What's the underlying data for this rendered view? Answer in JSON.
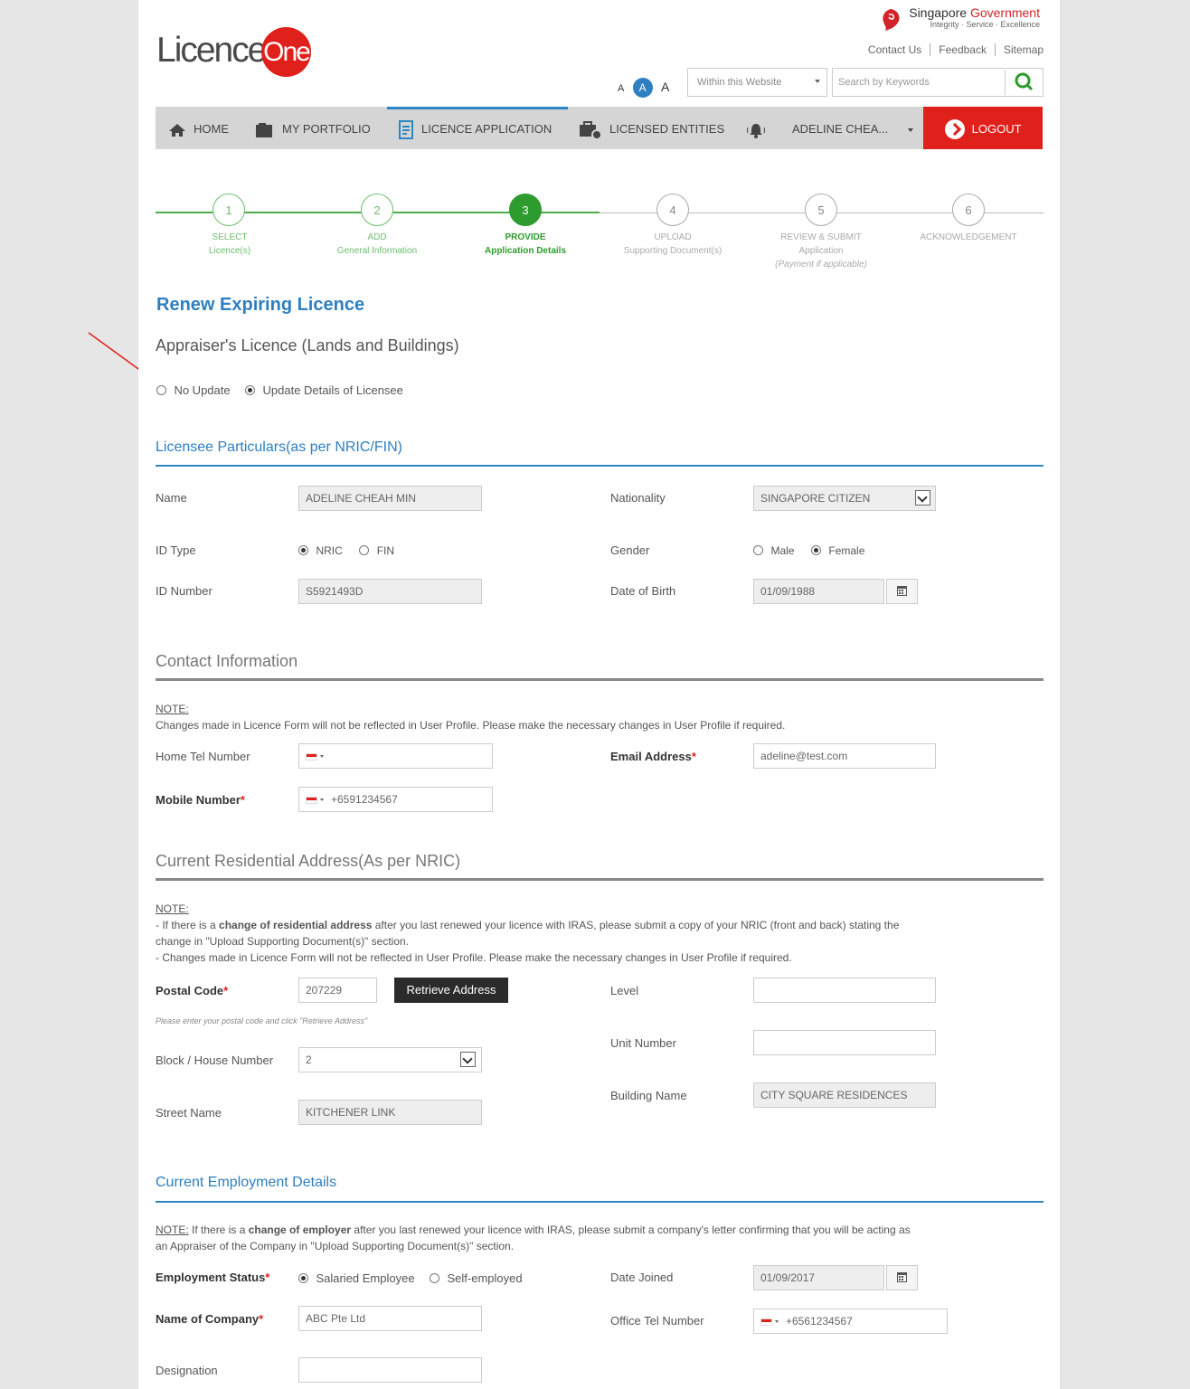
{
  "header": {
    "logo_left": "Licence",
    "logo_right": "One",
    "gov_title_1": "Singapore ",
    "gov_title_2": "Government",
    "gov_tagline": "Integrity · Service · Excellence",
    "links": [
      "Contact Us",
      "Feedback",
      "Sitemap"
    ],
    "font_small": "A",
    "font_medium": "A",
    "font_large": "A",
    "scope_select": "Within this Website",
    "search_placeholder": "Search by Keywords"
  },
  "nav": {
    "home": "HOME",
    "portfolio": "MY PORTFOLIO",
    "licence_application": "LICENCE APPLICATION",
    "licensed_entities": "LICENSED ENTITIES",
    "user": "ADELINE CHEA...",
    "logout": "LOGOUT"
  },
  "steps": [
    {
      "num": "1",
      "line1": "SELECT",
      "line2": "Licence(s)",
      "line3": ""
    },
    {
      "num": "2",
      "line1": "ADD",
      "line2": "General Information",
      "line3": ""
    },
    {
      "num": "3",
      "line1": "PROVIDE",
      "line2": "Application Details",
      "line3": ""
    },
    {
      "num": "4",
      "line1": "UPLOAD",
      "line2": "Supporting Document(s)",
      "line3": ""
    },
    {
      "num": "5",
      "line1": "REVIEW & SUBMIT",
      "line2": "Application",
      "line3": "(Payment if applicable)"
    },
    {
      "num": "6",
      "line1": "ACKNOWLEDGEMENT",
      "line2": "",
      "line3": ""
    }
  ],
  "page": {
    "title": "Renew Expiring Licence",
    "subtitle": "Appraiser's Licence (Lands and Buildings)",
    "option_no_update": "No Update",
    "option_update": "Update Details of Licensee",
    "selected_option": "Update Details of Licensee"
  },
  "licensee": {
    "heading": "Licensee Particulars(as per NRIC/FIN)",
    "name_label": "Name",
    "name_value": "ADELINE CHEAH MIN",
    "nationality_label": "Nationality",
    "nationality_value": "SINGAPORE CITIZEN",
    "idtype_label": "ID Type",
    "idtype_nric": "NRIC",
    "idtype_fin": "FIN",
    "idtype_selected": "NRIC",
    "gender_label": "Gender",
    "gender_male": "Male",
    "gender_female": "Female",
    "gender_selected": "Female",
    "idnumber_label": "ID Number",
    "idnumber_value": "S5921493D",
    "dob_label": "Date of Birth",
    "dob_value": "01/09/1988"
  },
  "contact": {
    "heading": "Contact Information",
    "note_label": "NOTE:",
    "note_text": "Changes made in Licence Form will not be reflected in User Profile. Please make the necessary changes in User Profile if required.",
    "home_tel_label": "Home Tel Number",
    "home_tel_value": "",
    "email_label": "Email Address",
    "email_value": "adeline@test.com",
    "mobile_label": "Mobile Number",
    "mobile_value": "+6591234567",
    "required_mark": "*"
  },
  "address": {
    "heading": "Current Residential Address(As per NRIC)",
    "note_label": "NOTE:",
    "note_line1_a": "- If there is a ",
    "note_line1_b": "change of residential address",
    "note_line1_c": " after you last renewed your licence with IRAS, please submit a copy of your NRIC (front and back) stating the",
    "note_line2": "change in \"Upload Supporting Document(s)\" section.",
    "note_line3": "- Changes made in Licence Form will not be reflected in User Profile. Please make the necessary changes in User Profile if required.",
    "postal_label": "Postal Code",
    "postal_value": "207229",
    "retrieve_button": "Retrieve Address",
    "postal_hint": "Please enter your postal code and click \"Retrieve Address\"",
    "level_label": "Level",
    "level_value": "",
    "unit_label": "Unit Number",
    "unit_value": "",
    "block_label": "Block / House Number",
    "block_value": "2",
    "building_label": "Building Name",
    "building_value": "CITY SQUARE RESIDENCES",
    "street_label": "Street Name",
    "street_value": "KITCHENER LINK"
  },
  "employment": {
    "heading": "Current Employment Details",
    "note_label": "NOTE:",
    "note_a": " If there is a ",
    "note_b": "change of employer",
    "note_c": " after you last renewed your licence with IRAS, please submit a company's letter confirming that you will be acting as",
    "note_line2": "an Appraiser of the Company in \"Upload Supporting Document(s)\" section.",
    "status_label": "Employment Status",
    "status_salaried": "Salaried Employee",
    "status_self": "Self-employed",
    "status_selected": "Salaried Employee",
    "date_joined_label": "Date Joined",
    "date_joined_value": "01/09/2017",
    "company_label": "Name of Company",
    "company_value": "ABC Pte Ltd",
    "office_tel_label": "Office Tel Number",
    "office_tel_value": "+6561234567",
    "designation_label": "Designation",
    "designation_value": ""
  },
  "colors": {
    "accent_blue": "#2d7fc1",
    "logout_red": "#e0201b",
    "step_green": "#2e9b2e",
    "annotation_arrow": "#e0201b"
  }
}
